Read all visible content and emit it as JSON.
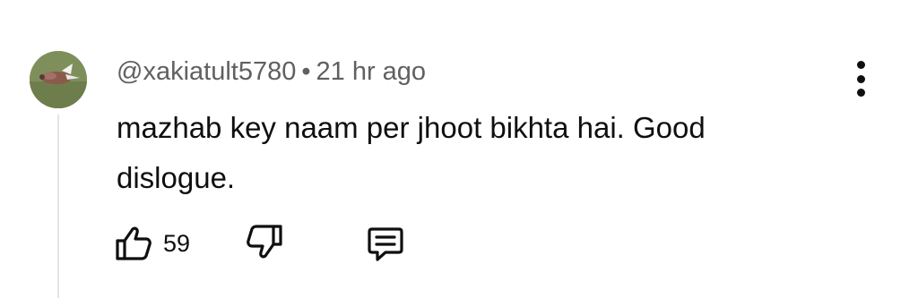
{
  "comment": {
    "author": "@xakiatult5780",
    "separator": "•",
    "time": "21 hr ago",
    "text": "mazhab key naam per jhoot bikhta hai. Good dislogue.",
    "avatar_icon": "bird-photo-avatar",
    "more_icon": "vertical-ellipsis-icon"
  },
  "actions": {
    "like_icon": "thumbs-up-icon",
    "like_count": "59",
    "dislike_icon": "thumbs-down-icon",
    "reply_icon": "reply-comment-icon"
  },
  "colors": {
    "text": "#0f0f0f",
    "meta_text": "#606060",
    "thread_line": "#e5e5e5",
    "background": "#ffffff"
  }
}
